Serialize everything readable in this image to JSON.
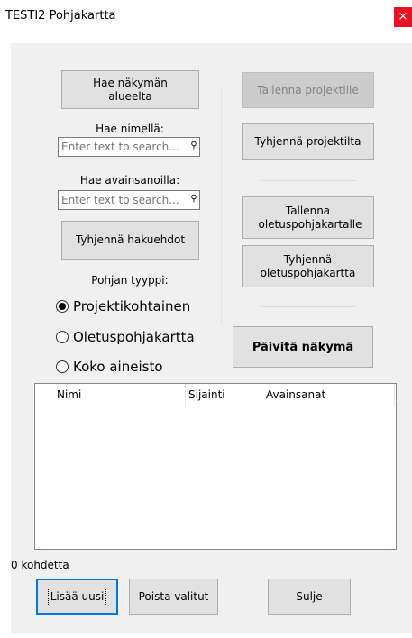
{
  "window": {
    "title": "TESTI2 Pohjakartta",
    "close_glyph": "×"
  },
  "left": {
    "fetch_view_area": "Hae näkymän alueelta",
    "search_by_name_label": "Hae nimellä:",
    "search_by_name_placeholder": "Enter text to search...",
    "search_by_keywords_label": "Hae avainsanoilla:",
    "search_by_keywords_placeholder": "Enter text to search...",
    "clear_search": "Tyhjennä hakuehdot",
    "map_type_label": "Pohjan tyyppi:",
    "radio_options": [
      {
        "label": "Projektikohtainen",
        "checked": true
      },
      {
        "label": "Oletuspohjakartta",
        "checked": false
      },
      {
        "label": "Koko aineisto",
        "checked": false
      }
    ]
  },
  "right": {
    "save_to_project": "Tallenna projektille",
    "clear_from_project": "Tyhjennä projektilta",
    "save_default_map": "Tallenna oletuspohjakartalle",
    "clear_default_map": "Tyhjennä oletuspohjakartta",
    "refresh_view": "Päivitä näkymä"
  },
  "list": {
    "columns": [
      "Nimi",
      "Sijainti",
      "Avainsanat"
    ],
    "rows": []
  },
  "status_text": "0 kohdetta",
  "footer": {
    "add_new": "Lisää uusi",
    "remove_selected": "Poista valitut",
    "close": "Sulje"
  },
  "colors": {
    "close_button": "#e81123",
    "panel_background": "#f0f0f0",
    "button_background": "#e1e1e1",
    "focus_border": "#0078d7"
  },
  "icons": {
    "search_buttons": "search-icon",
    "close": "close-icon"
  }
}
